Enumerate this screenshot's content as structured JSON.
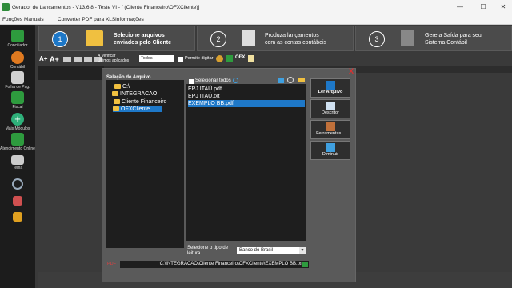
{
  "window": {
    "title": "Gerador de Lançamentos - V13.6.8 - Teste VI - [ (Cliente Financeiro\\OFXCliente)]",
    "minimize": "—",
    "maximize": "☐",
    "close": "✕"
  },
  "menu": [
    "Funções",
    "Manuais",
    "Converter PDF para XLS",
    "Informações"
  ],
  "sidebar": [
    {
      "label": "Conciliador",
      "icon": "conciliador-icon",
      "color": "#2e9b3e"
    },
    {
      "label": "Contábil",
      "icon": "contabil-icon",
      "color": "#e07a20"
    },
    {
      "label": "Folha de Pag.",
      "icon": "folha-icon",
      "color": "#d0d0d0"
    },
    {
      "label": "Fiscal",
      "icon": "fiscal-icon",
      "color": "#2e9b3e"
    },
    {
      "label": "Mais Módulos",
      "icon": "plus-icon",
      "color": "#2eb07a"
    },
    {
      "label": "Atendimento Online",
      "icon": "atendimento-icon",
      "color": "#2e9b3e"
    },
    {
      "label": "Tema",
      "icon": "monitor-icon",
      "color": "#cccccc"
    }
  ],
  "steps": [
    {
      "num": "1",
      "line1": "Selecione arquivos",
      "line2": "enviados pelo Cliente",
      "active": true
    },
    {
      "num": "2",
      "line1": "Produza lançamentos",
      "line2": "com as contas contábeis",
      "active": false
    },
    {
      "num": "3",
      "line1": "Gere a Saída para seu",
      "line2": "Sistema Contábil",
      "active": false
    }
  ],
  "toolbar": {
    "font_inc": "A+",
    "font_dec": "A+",
    "verify": "A Verificar",
    "last_applied": "Últimos aplicados",
    "filter_value": "Todos",
    "permit_label": "Permite digitar",
    "ofx": "OFX"
  },
  "dialog": {
    "close": "X",
    "section_title": "Seleção de Arquivo",
    "select_all": "Selecionar todos",
    "tree": [
      "C:\\",
      "INTEGRACAO",
      "Cliente Financeiro",
      "OFXCliente"
    ],
    "files": [
      "EPJ ITAÚ.pdf",
      "EPJ ITAÚ.txt",
      "EXEMPLO BB.pdf"
    ],
    "selected_file_index": 2,
    "buttons": [
      "Ler Arquivo",
      "Descritor",
      "Ferramentas...",
      "Diminuir"
    ],
    "read_type_label": "Selecione o tipo de leitura",
    "read_type_value": "Banco do Brasil",
    "path_label": "PDF",
    "path_value": "C:\\INTEGRACAO\\Cliente Financeiro\\OFXCliente\\EXEMPLO BB.txt"
  },
  "colors": {
    "accent": "#1e78c8",
    "selection": "#1e78c8",
    "folder": "#f0c040"
  }
}
